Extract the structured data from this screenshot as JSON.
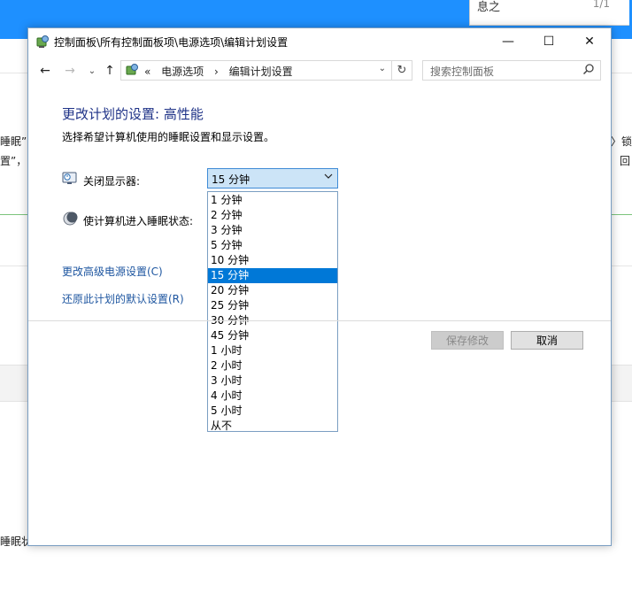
{
  "background": {
    "top_right_label": "息之",
    "top_right_count": "1/1",
    "side_texts": [
      "睡眠”",
      "置”，改",
      "〉锁",
      "回",
      "睡眠状"
    ]
  },
  "window": {
    "title": "控制面板\\所有控制面板项\\电源选项\\编辑计划设置",
    "controls": {
      "minimize": "—",
      "maximize": "☐",
      "close": "✕"
    }
  },
  "navbar": {
    "back": "←",
    "forward": "→",
    "recent": "⌄",
    "up": "↑",
    "breadcrumb_prefix": "«",
    "breadcrumbs": [
      "电源选项",
      "›",
      "编辑计划设置"
    ],
    "dropdown": "⌄",
    "refresh": "↻",
    "search_placeholder": "搜索控制面板"
  },
  "main": {
    "heading": "更改计划的设置: 高性能",
    "subheading": "选择希望计算机使用的睡眠设置和显示设置。",
    "display_off_label": "关闭显示器:",
    "sleep_label": "使计算机进入睡眠状态:",
    "display_off_value": "15 分钟",
    "dropdown_options": [
      "1 分钟",
      "2 分钟",
      "3 分钟",
      "5 分钟",
      "10 分钟",
      "15 分钟",
      "20 分钟",
      "25 分钟",
      "30 分钟",
      "45 分钟",
      "1 小时",
      "2 小时",
      "3 小时",
      "4 小时",
      "5 小时",
      "从不"
    ],
    "selected_index": 5,
    "link_advanced": "更改高级电源设置(C)",
    "link_restore": "还原此计划的默认设置(R)",
    "save_button": "保存修改",
    "cancel_button": "取消"
  }
}
